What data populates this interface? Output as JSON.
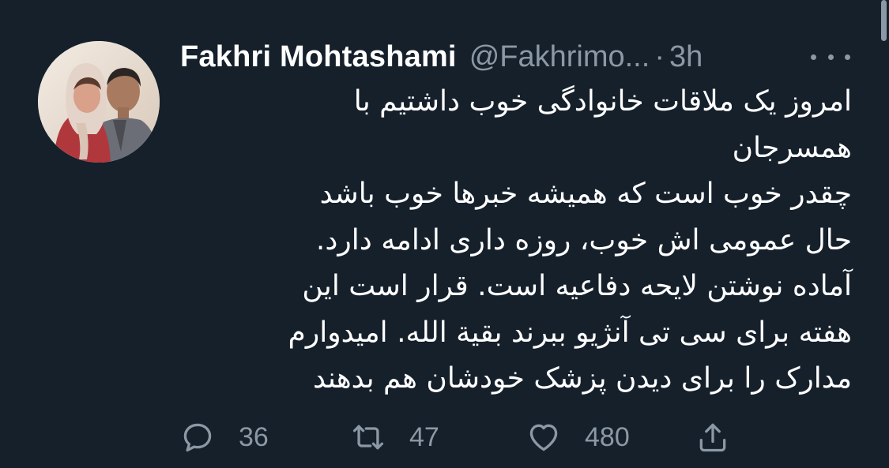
{
  "tweet": {
    "display_name": "Fakhri Mohtashami",
    "handle": "@Fakhrimo...",
    "separator": "·",
    "time": "3h",
    "more_icon": "more-horizontal-icon",
    "body_lines": [
      "امروز یک ملاقات خانوادگی خوب داشتیم با",
      "همسرجان",
      "چقدر خوب است که همیشه خبرها خوب باشد",
      "حال عمومی اش خوب، روزه داری ادامه دارد.",
      "آماده نوشتن لایحه دفاعیه است. قرار است این",
      "هفته برای سی تی آنژیو ببرند بقیة الله. امیدوارم",
      "مدارک را برای دیدن پزشک خودشان هم بدهند"
    ],
    "actions": {
      "reply": {
        "icon": "reply-icon",
        "count": "36"
      },
      "retweet": {
        "icon": "retweet-icon",
        "count": "47"
      },
      "like": {
        "icon": "heart-icon",
        "count": "480"
      },
      "share": {
        "icon": "share-icon"
      }
    }
  },
  "colors": {
    "background": "#15202b",
    "primary_text": "#ffffff",
    "secondary_text": "#8b98a5"
  }
}
